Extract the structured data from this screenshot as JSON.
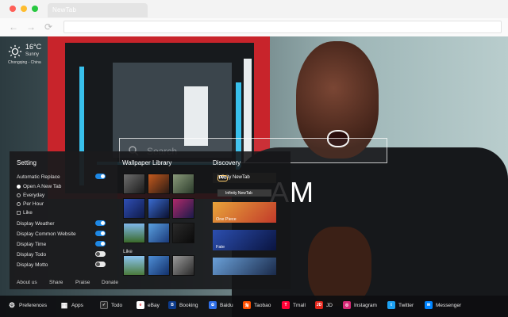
{
  "browser": {
    "tab_title": "NewTab"
  },
  "weather": {
    "temp": "16°C",
    "condition": "Sunny",
    "location": "Chongqing - China"
  },
  "search": {
    "placeholder": "Search"
  },
  "clock": {
    "time": "AM",
    "date": "n"
  },
  "panel": {
    "setting_title": "Setting",
    "auto_replace": "Automatic Replace",
    "replace_options": [
      "Open A New Tab",
      "Everyday",
      "Per Hour",
      "Like"
    ],
    "display_options": [
      "Display Weather",
      "Display Common Website",
      "Display Time",
      "Display Todo",
      "Display Motto"
    ],
    "display_states": [
      true,
      true,
      true,
      false,
      false
    ],
    "footer_links": [
      "About us",
      "Share",
      "Praise",
      "Donate"
    ],
    "wallpaper_title": "Wallpaper Library",
    "like_label": "Like",
    "discovery_title": "Discovery",
    "discovery_top": "Infinity NewTab",
    "discovery_pro": "Pro",
    "discovery_bar": "Infinity NewTab",
    "discovery_cards": [
      "One Piece",
      "Fate",
      ""
    ]
  },
  "dock": {
    "items": [
      {
        "label": "Preferences",
        "icon": "gear-icon",
        "color": "#000000"
      },
      {
        "label": "Apps",
        "icon": "apps-icon",
        "color": "#000000"
      },
      {
        "label": "Todo",
        "icon": "todo-icon",
        "color": "#2b2b2b"
      },
      {
        "label": "eBay",
        "icon": "ebay-icon",
        "color": "#ffffff"
      },
      {
        "label": "Booking",
        "icon": "booking-icon",
        "color": "#0c3b8c"
      },
      {
        "label": "Baidu",
        "icon": "baidu-icon",
        "color": "#2e6fe8"
      },
      {
        "label": "Taobao",
        "icon": "taobao-icon",
        "color": "#ff5000"
      },
      {
        "label": "Tmall",
        "icon": "tmall-icon",
        "color": "#ff0036"
      },
      {
        "label": "JD",
        "icon": "jd-icon",
        "color": "#e1251b"
      },
      {
        "label": "Instagram",
        "icon": "instagram-icon",
        "color": "#d62976"
      },
      {
        "label": "Twitter",
        "icon": "twitter-icon",
        "color": "#1da1f2"
      },
      {
        "label": "Messenger",
        "icon": "messenger-icon",
        "color": "#0084ff"
      }
    ]
  }
}
